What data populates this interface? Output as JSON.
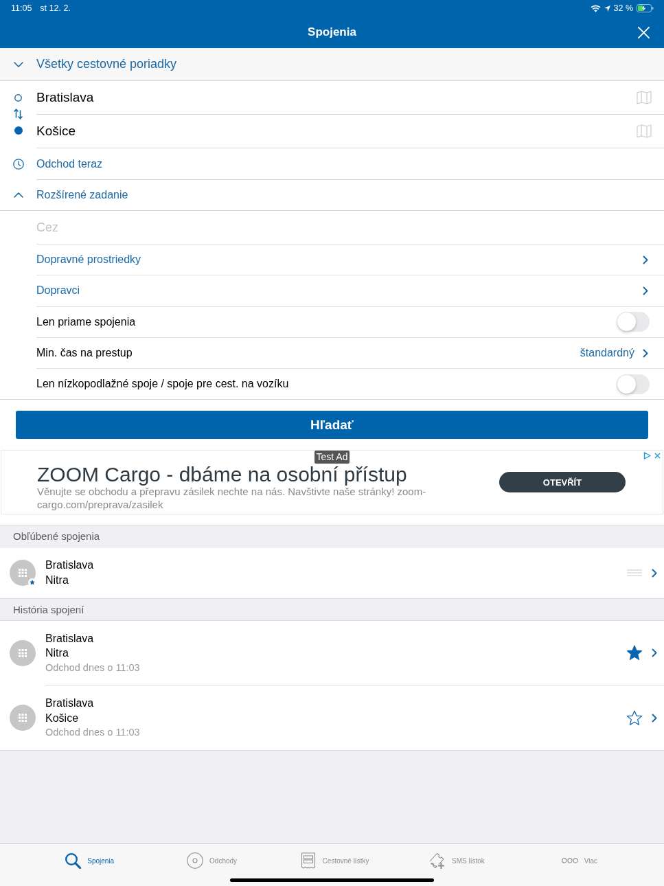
{
  "status_bar": {
    "time": "11:05",
    "date": "st 12. 2.",
    "battery": "32 %"
  },
  "nav_bar": {
    "title": "Spojenia"
  },
  "timetable_filter": {
    "label": "Všetky cestovné poriadky",
    "expanded": false
  },
  "route": {
    "from": "Bratislava",
    "to": "Košice"
  },
  "departure": {
    "label": "Odchod teraz"
  },
  "advanced": {
    "label": "Rozšírené zadanie",
    "expanded": true,
    "via": {
      "placeholder": "Cez"
    },
    "options": [
      {
        "kind": "link",
        "label": "Dopravné prostriedky"
      },
      {
        "kind": "link",
        "label": "Dopravci"
      },
      {
        "kind": "toggle",
        "label": "Len priame spojenia",
        "on": false
      },
      {
        "kind": "value",
        "label": "Min. čas na prestup",
        "value": "štandardný"
      },
      {
        "kind": "toggle",
        "label": "Len nízkopodlažné spoje / spoje pre cest. na vozíku",
        "on": false
      }
    ]
  },
  "search_button": {
    "label": "Hľadať"
  },
  "ad": {
    "badge": "Test Ad",
    "title": "ZOOM Cargo - dbáme na osobní přístup",
    "text": "Věnujte se obchodu a přepravu zásilek nechte na nás. Navštivte naše stránky! zoom-cargo.com/preprava/zasilek",
    "button": "OTEVŘÍT"
  },
  "favorites": {
    "title": "Obľúbené spojenia",
    "items": [
      {
        "from": "Bratislava",
        "to": "Nitra"
      }
    ]
  },
  "history": {
    "title": "História spojení",
    "items": [
      {
        "from": "Bratislava",
        "to": "Nitra",
        "departure": "Odchod dnes o 11:03",
        "favorite": true
      },
      {
        "from": "Bratislava",
        "to": "Košice",
        "departure": "Odchod dnes o 11:03",
        "favorite": false
      }
    ]
  },
  "tab_bar": {
    "tabs": [
      {
        "kind": "search",
        "label": "Spojenia",
        "selected": true
      },
      {
        "kind": "departures",
        "label": "Odchody",
        "selected": false
      },
      {
        "kind": "tickets",
        "label": "Cestovné lístky",
        "selected": false
      },
      {
        "kind": "sms",
        "label": "SMS lístok",
        "selected": false
      },
      {
        "kind": "more",
        "label": "Viac",
        "selected": false
      }
    ]
  }
}
